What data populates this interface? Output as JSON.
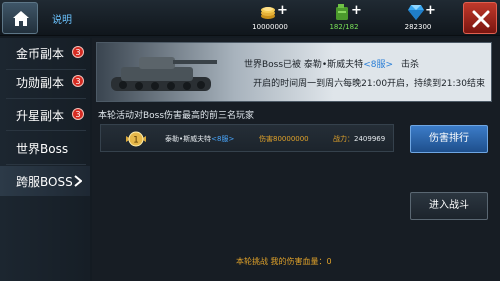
{
  "topbar": {
    "help_label": "说明",
    "gold": "10000000",
    "stamina": "182/182",
    "diamonds": "282300",
    "plus": "+"
  },
  "sidebar": {
    "items": [
      {
        "label": "金币副本",
        "badge": "3"
      },
      {
        "label": "功勋副本",
        "badge": "3"
      },
      {
        "label": "升星副本",
        "badge": "3"
      },
      {
        "label": "世界Boss"
      },
      {
        "label": "跨服BOSS"
      }
    ]
  },
  "banner": {
    "line1_prefix": "世界Boss已被 泰勒•斯威夫特",
    "line1_server": "<8服>",
    "line1_suffix": "击杀",
    "line2": "开启的时间周一到周六每晚21:00开启，持续到21:30结束"
  },
  "ranking": {
    "title": "本轮活动对Boss伤害最高的前三名玩家",
    "rows": [
      {
        "rank": "1",
        "name": "泰勒•斯威夫特",
        "server": "<8服>",
        "damage": "伤害80000000",
        "power_label": "战力：",
        "power": "2409969"
      }
    ]
  },
  "buttons": {
    "rank": "伤害排行",
    "fight": "进入战斗"
  },
  "footer": {
    "text": "本轮挑战 我的伤害血量：0"
  },
  "colors": {
    "accent_blue": "#2b7fd6",
    "gold_text": "#e0a22a",
    "close_red": "#c0392b"
  }
}
